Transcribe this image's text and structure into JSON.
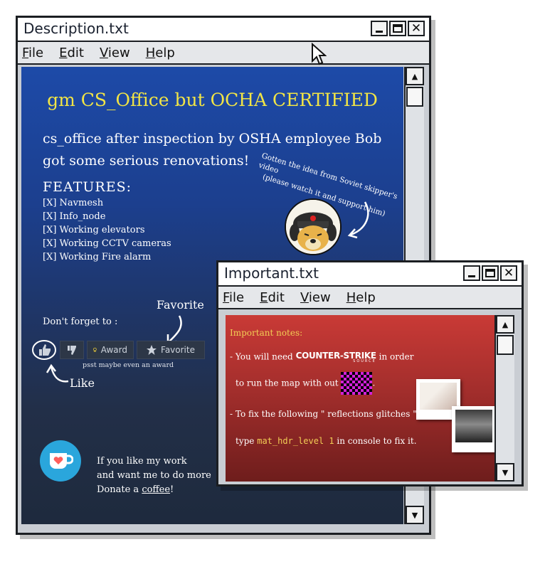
{
  "description_window": {
    "title": "Description.txt",
    "menu": [
      "File",
      "Edit",
      "View",
      "Help"
    ],
    "heading": "gm CS_Office but OCHA CERTIFIED",
    "intro_line1": "cs_office after inspection by OSHA employee Bob",
    "intro_line2": "got some serious renovations!",
    "features_heading": "FEATURES:",
    "features": [
      "[X] Navmesh",
      "[X] Info_node",
      "[X] Working elevators",
      "[X] Working CCTV cameras",
      "[X] Working Fire alarm"
    ],
    "credit_line1": "Gotten the idea from Soviet skipper's video",
    "credit_line2": "(please watch it and support him)",
    "dont_forget": "Don't forget to :",
    "favorite_callout": "Favorite",
    "like_callout": "Like",
    "award_label": "Award",
    "favorite_label": "Favorite",
    "psst": "psst maybe even an award",
    "donate_line1": "If you like my work",
    "donate_line2": "and want me to do more",
    "donate_prefix": "Donate a ",
    "donate_link": "coffee",
    "donate_suffix": "!"
  },
  "important_window": {
    "title": "Important.txt",
    "menu": [
      "File",
      "Edit",
      "View",
      "Help"
    ],
    "notes_heading": "Important notes:",
    "need_prefix": "- You will need",
    "logo_text": "COUNTER-STRIKE",
    "logo_sub": "SOURCE",
    "need_suffix": "in order",
    "run_text": "to run the map with out",
    "run_suffix": ".",
    "fix_text": "- To fix the following \" reflections glitches \" :",
    "type_prefix": "type",
    "command": "mat_hdr_level 1",
    "type_suffix": "in console to fix it."
  }
}
